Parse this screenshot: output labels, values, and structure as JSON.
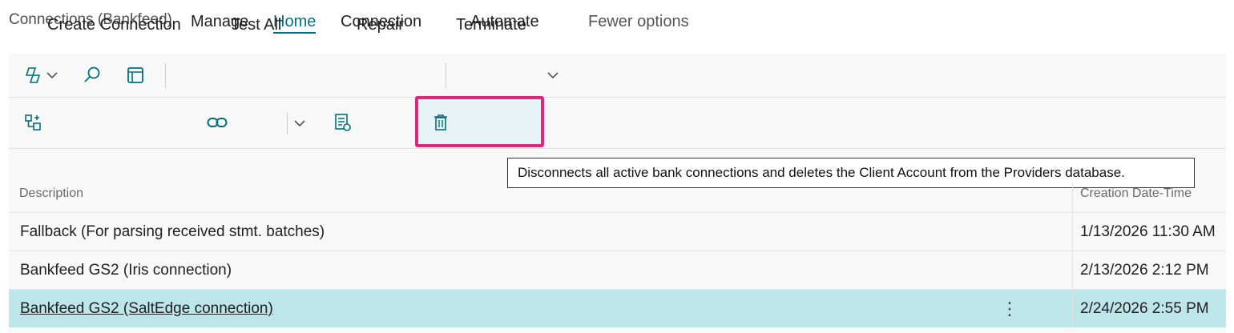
{
  "page_title": "Connections (Bankfeed)",
  "nav": {
    "manage": "Manage",
    "home": "Home",
    "connection": "Connection",
    "automate": "Automate",
    "fewer_options": "Fewer options"
  },
  "actions": {
    "create_connection": "Create Connection",
    "test_all": "Test All",
    "repair": "Repair",
    "terminate": "Terminate"
  },
  "tooltip": "Disconnects all active bank connections and deletes the Client Account from the Providers database.",
  "table": {
    "columns": [
      "Description",
      "Creation Date-Time"
    ],
    "rows": [
      {
        "description": "Fallback (For parsing received stmt. batches)",
        "created": "1/13/2026 11:30 AM"
      },
      {
        "description": "Bankfeed GS2 (Iris connection)",
        "created": "2/13/2026 2:12 PM"
      },
      {
        "description": "Bankfeed GS2 (SaltEdge connection)",
        "created": "2/24/2026 2:55 PM"
      }
    ],
    "selected_row_index": 2,
    "row_menu_glyph": "⋮"
  },
  "colors": {
    "accent": "#00707c",
    "highlight_border": "#e0267d",
    "selected_row": "#bce6ea"
  },
  "icons": [
    "copilot-icon",
    "chevron-down-icon",
    "search-icon",
    "edit-page-icon",
    "create-connection-icon",
    "link-icon",
    "repair-icon",
    "trash-icon"
  ]
}
